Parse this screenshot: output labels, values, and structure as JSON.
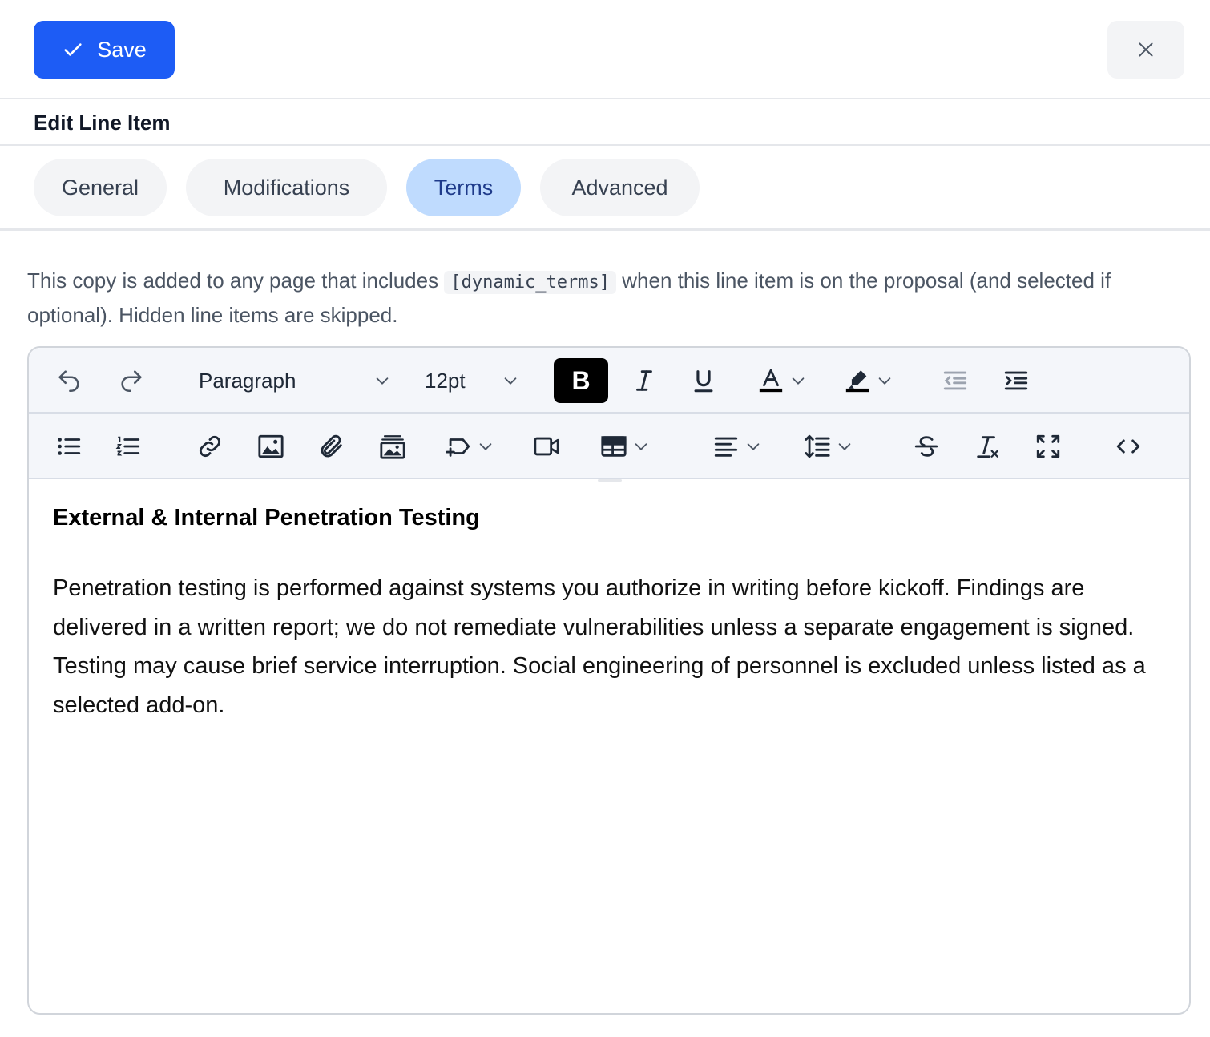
{
  "header": {
    "save_label": "Save",
    "title": "Edit Line Item"
  },
  "tabs": [
    {
      "label": "General",
      "active": false
    },
    {
      "label": "Modifications",
      "active": false
    },
    {
      "label": "Terms",
      "active": true
    },
    {
      "label": "Advanced",
      "active": false
    }
  ],
  "description": {
    "before": "This copy is added to any page that includes ",
    "code": "[dynamic_terms]",
    "after": " when this line item is on the proposal (and selected if optional). Hidden line items are skipped."
  },
  "toolbar": {
    "block_format": "Paragraph",
    "font_size": "12pt",
    "bold_label": "B"
  },
  "editor": {
    "heading": "External & Internal Penetration Testing",
    "body": "Penetration testing is performed against systems you authorize in writing before kickoff. Findings are delivered in a written report; we do not remediate vulnerabilities unless a separate engagement is signed. Testing may cause brief service interruption. Social engineering of personnel is excluded unless listed as a selected add-on."
  },
  "colors": {
    "primary": "#1d5cf5",
    "tab_active_bg": "#bfdbfe",
    "tab_active_text": "#1e3a8a",
    "tab_bg": "#f3f4f6"
  }
}
